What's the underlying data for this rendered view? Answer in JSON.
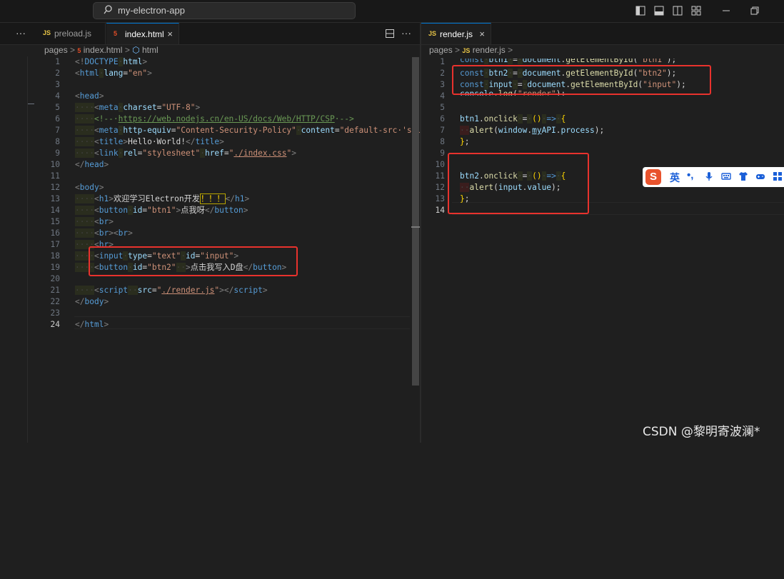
{
  "titlebar": {
    "search_text": "my-electron-app",
    "icons": [
      "toggle-primary-sidebar-icon",
      "toggle-panel-icon",
      "toggle-secondary-sidebar-icon",
      "customize-layout-icon",
      "minimize-icon",
      "restore-icon"
    ]
  },
  "left_editor": {
    "more_label": "···",
    "tabs": [
      {
        "icon": "JS",
        "label": "preload.js",
        "active": false
      },
      {
        "icon": "5",
        "label": "index.html",
        "active": true,
        "close": "×"
      }
    ],
    "breadcrumb": {
      "parts": [
        "pages",
        ">",
        "index.html",
        ">",
        "html"
      ]
    },
    "current_line": "24"
  },
  "right_editor": {
    "tabs": [
      {
        "icon": "JS",
        "label": "render.js",
        "active": true,
        "close": "×"
      }
    ],
    "breadcrumb": {
      "parts": [
        "pages",
        ">",
        "render.js",
        ">"
      ]
    },
    "current_line": "14"
  },
  "ime_toolbar": {
    "logo": "S",
    "lang": "英",
    "punct": "•,",
    "icons": [
      "microphone-icon",
      "keyboard-icon",
      "skin-icon",
      "gamepad-icon",
      "grid-icon"
    ]
  },
  "watermark": "CSDN @黎明寄波澜*",
  "colors": {
    "accent": "#0078d4",
    "annotation_red": "#e8322d",
    "keyword": "#569cd6",
    "string": "#ce9178",
    "attribute": "#9cdcfe",
    "comment": "#6a9955"
  }
}
